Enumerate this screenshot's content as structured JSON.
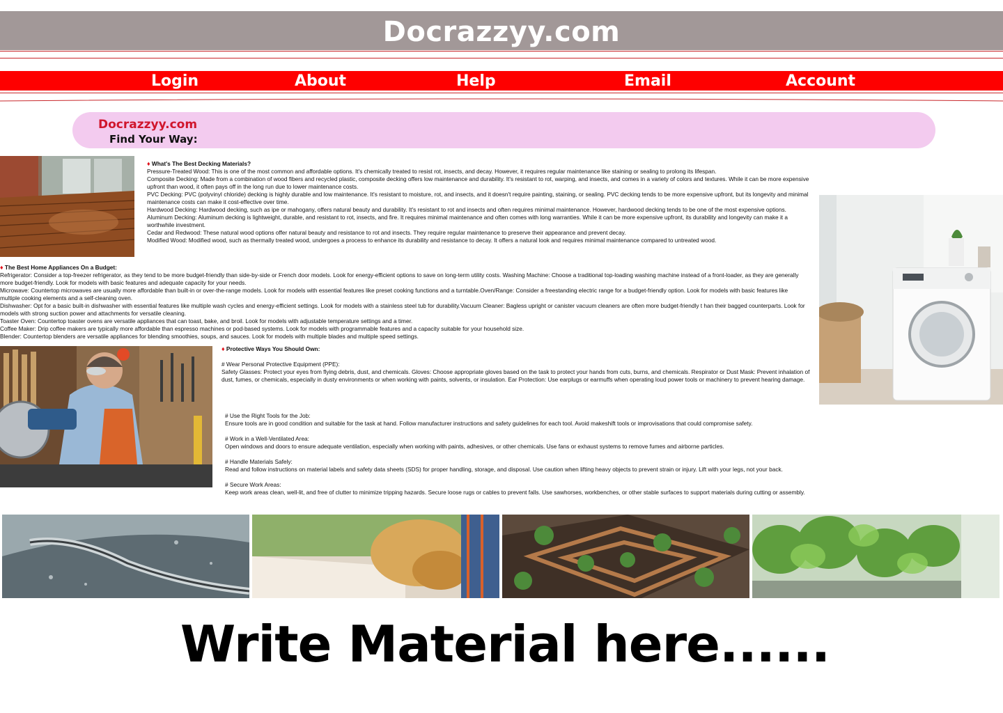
{
  "site": {
    "title": "Docrazzyy.com"
  },
  "nav": {
    "items": [
      "Login",
      "About",
      "Help",
      "Email",
      "Account"
    ]
  },
  "search": {
    "brand": "Docrazzyy.com",
    "label": "Find Your Way:"
  },
  "decking": {
    "heading": "What's The Best Decking Materials?",
    "lines": [
      "Pressure-Treated Wood: This is one of the most common and affordable options. It's chemically treated to resist rot, insects, and decay. However, it requires regular maintenance like staining or sealing to prolong its lifespan.",
      "Composite Decking: Made from a combination of wood fibers and recycled plastic, composite decking offers low maintenance and durability. It's resistant to rot, warping, and insects, and comes in a variety of colors and textures. While it can be more expensive upfront than wood, it often pays off in the long run due to lower maintenance costs.",
      "PVC Decking: PVC (polyvinyl chloride) decking is highly durable and low maintenance. It's resistant to moisture, rot, and insects, and it doesn't require painting, staining, or sealing. PVC decking tends to be more expensive upfront, but its longevity and minimal maintenance costs can make it cost-effective over time.",
      "Hardwood Decking: Hardwood decking, such as ipe or mahogany, offers natural beauty and durability. It's resistant to rot and insects and often requires minimal maintenance. However, hardwood decking tends to be one of the most expensive options.",
      "Aluminum Decking: Aluminum decking is lightweight, durable, and resistant to rot, insects, and fire. It requires minimal maintenance and often comes with long warranties. While it can be more expensive upfront, its durability and longevity can make it a worthwhile investment.",
      "Cedar and Redwood: These natural wood options offer natural beauty and resistance to rot and insects. They require regular maintenance to preserve their appearance and prevent decay.",
      "Modified Wood: Modified wood, such as thermally treated wood, undergoes a process to enhance its durability and resistance to decay. It offers a natural look and requires minimal maintenance compared to untreated wood."
    ]
  },
  "appliances": {
    "heading": "The Best Home Appliances On a Budget:",
    "lines": [
      "Refrigerator: Consider a top-freezer refrigerator, as they tend to be more budget-friendly than side-by-side or French door models. Look for energy-efficient options to save on long-term utility costs. Washing Machine: Choose a traditional top-loading washing machine instead of a front-loader, as they are generally more budget-friendly. Look for models with basic features and adequate capacity for your needs.",
      "Microwave: Countertop microwaves are usually more affordable than built-in or over-the-range models. Look for models with essential features like preset cooking functions and a turntable.Oven/Range: Consider a freestanding electric range for a budget-friendly option. Look for models with basic features like multiple cooking elements and a self-cleaning oven.",
      "Dishwasher: Opt for a basic built-in dishwasher with essential features like multiple wash cycles and energy-efficient settings. Look for models with a stainless steel tub for durability.Vacuum Cleaner: Bagless upright or canister vacuum cleaners are often more budget-friendly t han their bagged counterparts. Look for models with strong suction power and attachments for versatile cleaning.",
      "Toaster Oven: Countertop toaster ovens are versatile appliances that can toast, bake, and broil. Look for models with adjustable temperature settings and a timer.",
      "Coffee Maker: Drip coffee makers are typically more affordable than espresso machines or pod-based systems. Look for models with programmable features and a capacity suitable for your household size.",
      "Blender: Countertop blenders are versatile appliances for blending smoothies, soups, and sauces. Look for models with multiple blades and multiple speed settings."
    ]
  },
  "protective": {
    "heading": "Protective Ways You Should Own:",
    "ppe_heading": "# Wear Personal Protective Equipment (PPE):",
    "ppe_text": "Safety Glasses: Protect your eyes from flying debris, dust, and chemicals. Gloves: Choose appropriate gloves based on the task to protect your hands from cuts, burns, and chemicals. Respirator or Dust Mask: Prevent inhalation of dust, fumes, or chemicals, especially in dusty environments or when working with paints, solvents, or insulation. Ear Protection: Use earplugs or earmuffs when operating loud power tools or machinery to prevent hearing damage.",
    "sections": [
      {
        "heading": "# Use the Right Tools for the Job:",
        "text": "Ensure tools are in good condition and suitable for the task at hand. Follow manufacturer instructions and safety guidelines for each tool. Avoid makeshift tools or improvisations that could compromise safety."
      },
      {
        "heading": "# Work in a Well-Ventilated Area:",
        "text": "Open windows and doors to ensure adequate ventilation, especially when working with paints, adhesives, or other chemicals. Use fans or exhaust systems to remove fumes and airborne particles."
      },
      {
        "heading": "# Handle Materials Safely:",
        "text": "Read and follow instructions on material labels and safety data sheets (SDS) for proper handling, storage, and disposal. Use caution when lifting heavy objects to prevent strain or injury. Lift with your legs, not your back."
      },
      {
        "heading": "# Secure Work Areas:",
        "text": "Keep work areas clean, well-lit, and free of clutter to minimize tripping hazards. Secure loose rugs or cables to prevent falls. Use sawhorses, workbenches, or other stable surfaces to support materials during cutting or assembly."
      }
    ]
  },
  "footer": {
    "cta": "Write Material here......"
  }
}
